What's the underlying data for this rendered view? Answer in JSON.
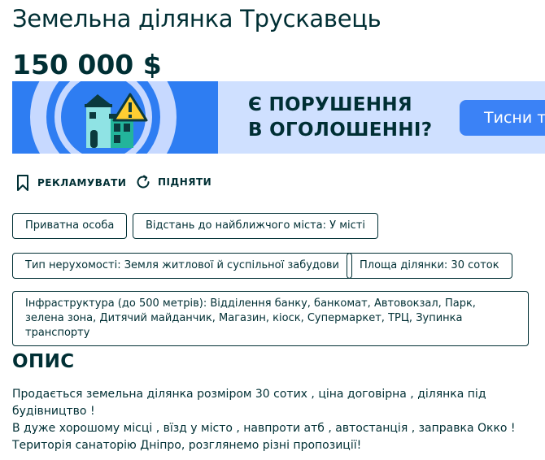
{
  "listing": {
    "title": "Земельна ділянка Трускавець",
    "price": "150 000 $"
  },
  "banner": {
    "headline_line1": "Є ПОРУШЕННЯ",
    "headline_line2": "В ОГОЛОШЕННІ?",
    "cta_label": "Тисни тут",
    "icon": "house-warning-icon",
    "colors": {
      "primary": "#2e7df2",
      "light": "#cfe0ff",
      "cta": "#3b82f6",
      "warning": "#ffce32"
    }
  },
  "actions": {
    "promote_label": "РЕКЛАМУВАТИ",
    "promote_icon": "bookmark-icon",
    "raise_label": "ПІДНЯТИ",
    "raise_icon": "refresh-icon"
  },
  "tags": [
    "Приватна особа",
    "Відстань до найближчого міста: У місті",
    "Тип нерухомості: Земля житлової й суспільної забудови",
    "Площа ділянки: 30 соток",
    "Інфраструктура (до 500 метрів): Відділення банку, банкомат, Автовокзал, Парк, зелена зона, Дитячий майданчик, Магазин, кіоск, Супермаркет, ТРЦ, Зупинка транспорту"
  ],
  "description": {
    "heading": "ОПИС",
    "lines": [
      "Продається земельна ділянка розміром 30 сотих , ціна договірна , ділянка під",
      "будівництво !",
      "В дуже хорошому місці , вїзд у місто , навпроти атб , автостанція , заправка Окко !",
      "Територія санаторію Дніпро, розглянемо різні пропозиції!"
    ]
  },
  "colors": {
    "text": "#002f34",
    "background": "#ffffff"
  }
}
